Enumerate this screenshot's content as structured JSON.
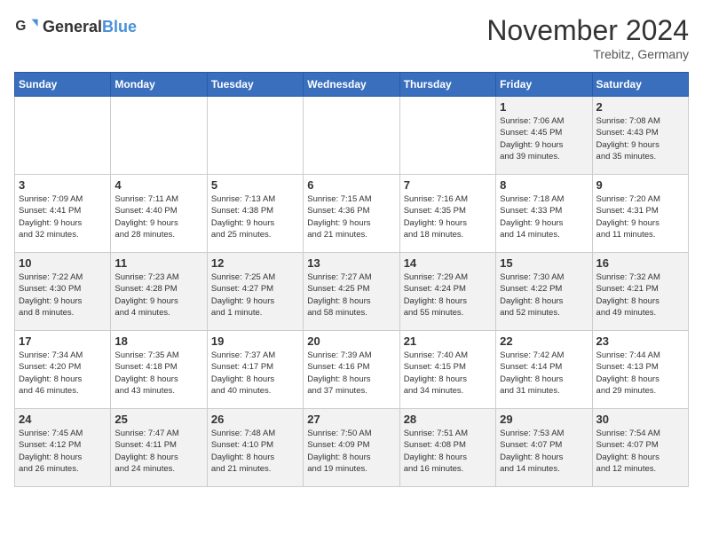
{
  "header": {
    "logo_general": "General",
    "logo_blue": "Blue",
    "month_title": "November 2024",
    "location": "Trebitz, Germany"
  },
  "weekdays": [
    "Sunday",
    "Monday",
    "Tuesday",
    "Wednesday",
    "Thursday",
    "Friday",
    "Saturday"
  ],
  "weeks": [
    [
      {
        "day": "",
        "info": ""
      },
      {
        "day": "",
        "info": ""
      },
      {
        "day": "",
        "info": ""
      },
      {
        "day": "",
        "info": ""
      },
      {
        "day": "",
        "info": ""
      },
      {
        "day": "1",
        "info": "Sunrise: 7:06 AM\nSunset: 4:45 PM\nDaylight: 9 hours\nand 39 minutes."
      },
      {
        "day": "2",
        "info": "Sunrise: 7:08 AM\nSunset: 4:43 PM\nDaylight: 9 hours\nand 35 minutes."
      }
    ],
    [
      {
        "day": "3",
        "info": "Sunrise: 7:09 AM\nSunset: 4:41 PM\nDaylight: 9 hours\nand 32 minutes."
      },
      {
        "day": "4",
        "info": "Sunrise: 7:11 AM\nSunset: 4:40 PM\nDaylight: 9 hours\nand 28 minutes."
      },
      {
        "day": "5",
        "info": "Sunrise: 7:13 AM\nSunset: 4:38 PM\nDaylight: 9 hours\nand 25 minutes."
      },
      {
        "day": "6",
        "info": "Sunrise: 7:15 AM\nSunset: 4:36 PM\nDaylight: 9 hours\nand 21 minutes."
      },
      {
        "day": "7",
        "info": "Sunrise: 7:16 AM\nSunset: 4:35 PM\nDaylight: 9 hours\nand 18 minutes."
      },
      {
        "day": "8",
        "info": "Sunrise: 7:18 AM\nSunset: 4:33 PM\nDaylight: 9 hours\nand 14 minutes."
      },
      {
        "day": "9",
        "info": "Sunrise: 7:20 AM\nSunset: 4:31 PM\nDaylight: 9 hours\nand 11 minutes."
      }
    ],
    [
      {
        "day": "10",
        "info": "Sunrise: 7:22 AM\nSunset: 4:30 PM\nDaylight: 9 hours\nand 8 minutes."
      },
      {
        "day": "11",
        "info": "Sunrise: 7:23 AM\nSunset: 4:28 PM\nDaylight: 9 hours\nand 4 minutes."
      },
      {
        "day": "12",
        "info": "Sunrise: 7:25 AM\nSunset: 4:27 PM\nDaylight: 9 hours\nand 1 minute."
      },
      {
        "day": "13",
        "info": "Sunrise: 7:27 AM\nSunset: 4:25 PM\nDaylight: 8 hours\nand 58 minutes."
      },
      {
        "day": "14",
        "info": "Sunrise: 7:29 AM\nSunset: 4:24 PM\nDaylight: 8 hours\nand 55 minutes."
      },
      {
        "day": "15",
        "info": "Sunrise: 7:30 AM\nSunset: 4:22 PM\nDaylight: 8 hours\nand 52 minutes."
      },
      {
        "day": "16",
        "info": "Sunrise: 7:32 AM\nSunset: 4:21 PM\nDaylight: 8 hours\nand 49 minutes."
      }
    ],
    [
      {
        "day": "17",
        "info": "Sunrise: 7:34 AM\nSunset: 4:20 PM\nDaylight: 8 hours\nand 46 minutes."
      },
      {
        "day": "18",
        "info": "Sunrise: 7:35 AM\nSunset: 4:18 PM\nDaylight: 8 hours\nand 43 minutes."
      },
      {
        "day": "19",
        "info": "Sunrise: 7:37 AM\nSunset: 4:17 PM\nDaylight: 8 hours\nand 40 minutes."
      },
      {
        "day": "20",
        "info": "Sunrise: 7:39 AM\nSunset: 4:16 PM\nDaylight: 8 hours\nand 37 minutes."
      },
      {
        "day": "21",
        "info": "Sunrise: 7:40 AM\nSunset: 4:15 PM\nDaylight: 8 hours\nand 34 minutes."
      },
      {
        "day": "22",
        "info": "Sunrise: 7:42 AM\nSunset: 4:14 PM\nDaylight: 8 hours\nand 31 minutes."
      },
      {
        "day": "23",
        "info": "Sunrise: 7:44 AM\nSunset: 4:13 PM\nDaylight: 8 hours\nand 29 minutes."
      }
    ],
    [
      {
        "day": "24",
        "info": "Sunrise: 7:45 AM\nSunset: 4:12 PM\nDaylight: 8 hours\nand 26 minutes."
      },
      {
        "day": "25",
        "info": "Sunrise: 7:47 AM\nSunset: 4:11 PM\nDaylight: 8 hours\nand 24 minutes."
      },
      {
        "day": "26",
        "info": "Sunrise: 7:48 AM\nSunset: 4:10 PM\nDaylight: 8 hours\nand 21 minutes."
      },
      {
        "day": "27",
        "info": "Sunrise: 7:50 AM\nSunset: 4:09 PM\nDaylight: 8 hours\nand 19 minutes."
      },
      {
        "day": "28",
        "info": "Sunrise: 7:51 AM\nSunset: 4:08 PM\nDaylight: 8 hours\nand 16 minutes."
      },
      {
        "day": "29",
        "info": "Sunrise: 7:53 AM\nSunset: 4:07 PM\nDaylight: 8 hours\nand 14 minutes."
      },
      {
        "day": "30",
        "info": "Sunrise: 7:54 AM\nSunset: 4:07 PM\nDaylight: 8 hours\nand 12 minutes."
      }
    ]
  ]
}
